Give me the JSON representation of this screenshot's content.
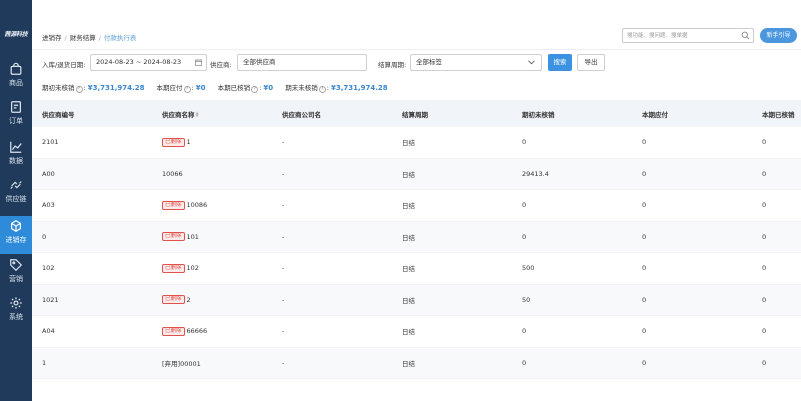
{
  "sidebar": {
    "logo": "茜源科技",
    "items": [
      {
        "label": "商品",
        "icon": "shopping-bag-icon"
      },
      {
        "label": "订单",
        "icon": "order-doc-icon"
      },
      {
        "label": "数据",
        "icon": "line-chart-icon"
      },
      {
        "label": "供应链",
        "icon": "exchange-arrows-icon"
      },
      {
        "label": "进销存",
        "icon": "warehouse-icon",
        "active": true
      },
      {
        "label": "营销",
        "icon": "tag-icon"
      },
      {
        "label": "系统",
        "icon": "gear-icon"
      }
    ],
    "bg_color": "#1f3a5a",
    "active_color": "#2e8bd9"
  },
  "header": {
    "breadcrumb": [
      "进销存",
      "财务结算",
      "付款执行表"
    ],
    "search_placeholder": "搜功能、搜问题、搜单据",
    "guide_button": "新手引导"
  },
  "filters": {
    "date_label": "入库/退货日期:",
    "date_range": "2024-08-23 ~ 2024-08-23",
    "supplier_label": "供应商:",
    "supplier_value": "全部供应商",
    "period_label": "结算周期:",
    "period_value": "全部标签",
    "search_button": "搜索",
    "export_button": "导出"
  },
  "summary": [
    {
      "label": "期初未核销",
      "value": "¥3,731,974.28"
    },
    {
      "label": "本期应付",
      "value": "¥0"
    },
    {
      "label": "本期已核销",
      "value": "¥0"
    },
    {
      "label": "期末未核销",
      "value": "¥3,731,974.28"
    }
  ],
  "table": {
    "columns": [
      "供应商编号",
      "供应商名称",
      "供应商公司名",
      "结算周期",
      "期初未核销",
      "本期应付",
      "本期已核销"
    ],
    "deleted_tag": "已删除",
    "rows": [
      {
        "code": "2101",
        "deleted": true,
        "name": "1",
        "company": "-",
        "period": "日结",
        "opening": "0",
        "payable": "0",
        "settled": "0"
      },
      {
        "code": "A00",
        "deleted": false,
        "name": "10066",
        "company": "-",
        "period": "日结",
        "opening": "29413.4",
        "payable": "0",
        "settled": "0"
      },
      {
        "code": "A03",
        "deleted": true,
        "name": "10086",
        "company": "-",
        "period": "日结",
        "opening": "0",
        "payable": "0",
        "settled": "0"
      },
      {
        "code": "0",
        "deleted": true,
        "name": "101",
        "company": "-",
        "period": "日结",
        "opening": "0",
        "payable": "0",
        "settled": "0"
      },
      {
        "code": "102",
        "deleted": true,
        "name": "102",
        "company": "-",
        "period": "日结",
        "opening": "500",
        "payable": "0",
        "settled": "0"
      },
      {
        "code": "1021",
        "deleted": true,
        "name": "2",
        "company": "-",
        "period": "日结",
        "opening": "50",
        "payable": "0",
        "settled": "0"
      },
      {
        "code": "A04",
        "deleted": true,
        "name": "66666",
        "company": "-",
        "period": "日结",
        "opening": "0",
        "payable": "0",
        "settled": "0"
      },
      {
        "code": "1",
        "deleted": false,
        "name": "[弃用]00001",
        "company": "-",
        "period": "日结",
        "opening": "0",
        "payable": "0",
        "settled": "0"
      }
    ]
  }
}
